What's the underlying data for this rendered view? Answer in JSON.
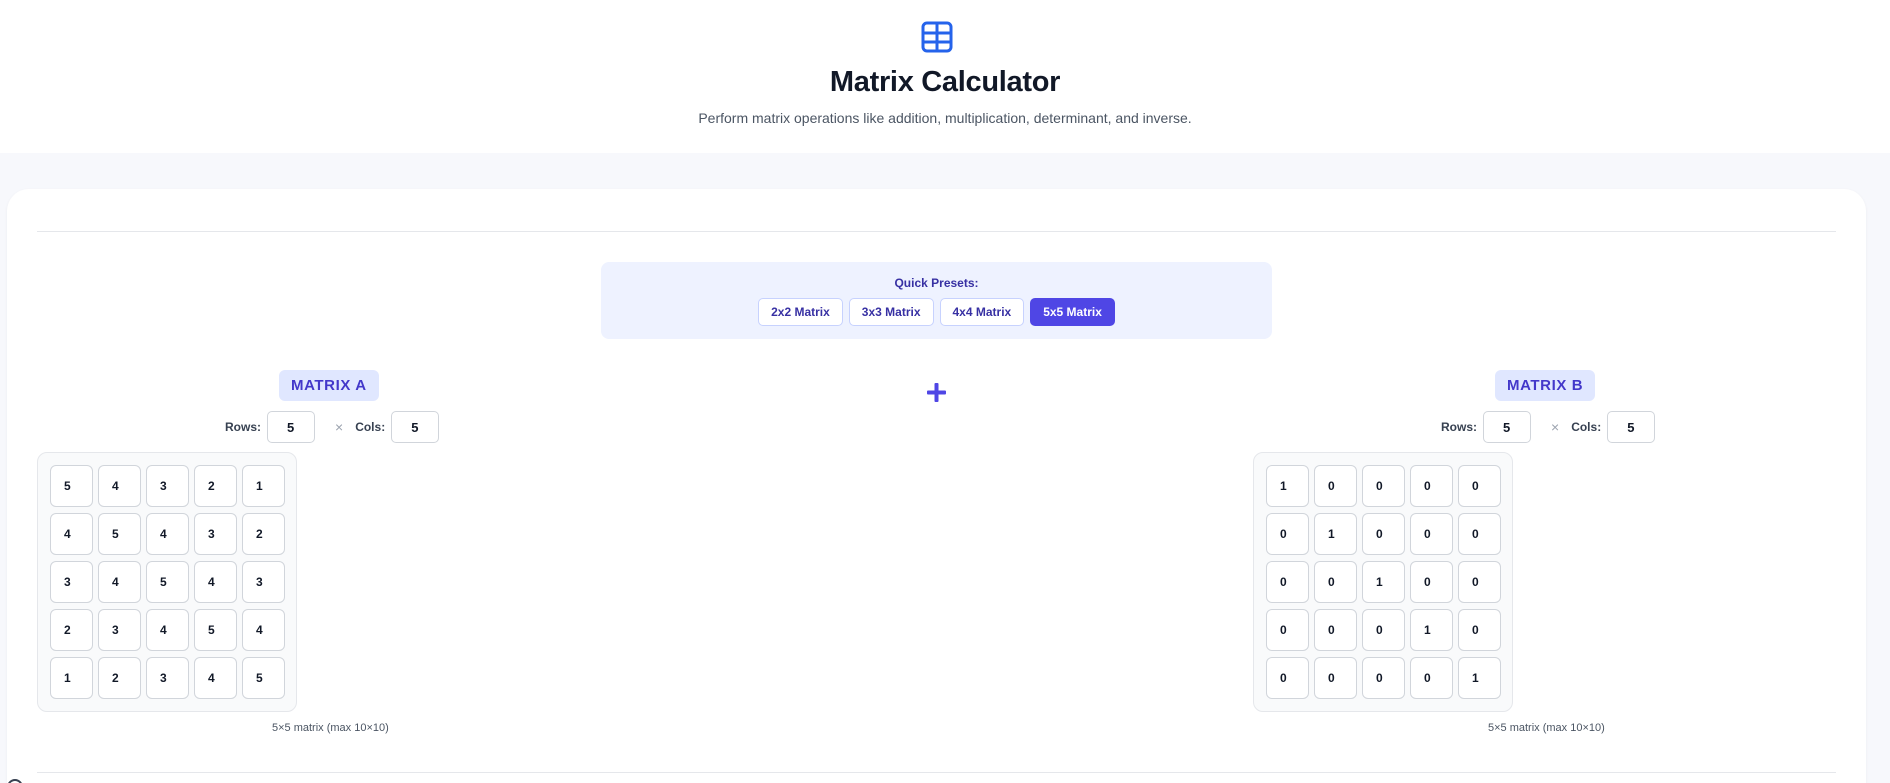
{
  "header": {
    "icon": "table-icon",
    "title": "Matrix Calculator",
    "subtitle": "Perform matrix operations like addition, multiplication, determinant, and inverse."
  },
  "presets": {
    "label": "Quick Presets:",
    "items": [
      {
        "label": "2x2 Matrix",
        "active": false
      },
      {
        "label": "3x3 Matrix",
        "active": false
      },
      {
        "label": "4x4 Matrix",
        "active": false
      },
      {
        "label": "5x5 Matrix",
        "active": true
      }
    ]
  },
  "operation": {
    "icon": "plus-icon",
    "symbol": "+"
  },
  "matrix_a": {
    "title": "MATRIX A",
    "rows_label": "Rows:",
    "cols_label": "Cols:",
    "rows": "5",
    "cols": "5",
    "times": "×",
    "values": [
      [
        "5",
        "4",
        "3",
        "2",
        "1"
      ],
      [
        "4",
        "5",
        "4",
        "3",
        "2"
      ],
      [
        "3",
        "4",
        "5",
        "4",
        "3"
      ],
      [
        "2",
        "3",
        "4",
        "5",
        "4"
      ],
      [
        "1",
        "2",
        "3",
        "4",
        "5"
      ]
    ],
    "note": "5×5 matrix (max 10×10)"
  },
  "matrix_b": {
    "title": "MATRIX B",
    "rows_label": "Rows:",
    "cols_label": "Cols:",
    "rows": "5",
    "cols": "5",
    "times": "×",
    "values": [
      [
        "1",
        "0",
        "0",
        "0",
        "0"
      ],
      [
        "0",
        "1",
        "0",
        "0",
        "0"
      ],
      [
        "0",
        "0",
        "1",
        "0",
        "0"
      ],
      [
        "0",
        "0",
        "0",
        "1",
        "0"
      ],
      [
        "0",
        "0",
        "0",
        "0",
        "1"
      ]
    ],
    "note": "5×5 matrix (max 10×10)"
  },
  "colors": {
    "accent": "#4f46e5",
    "badge_bg": "#e0e7ff",
    "preset_panel_bg": "#eef2ff",
    "logo": "#2563eb"
  }
}
